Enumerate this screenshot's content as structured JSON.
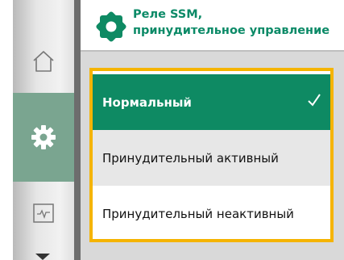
{
  "header": {
    "title_line1": "Реле SSM,",
    "title_line2": "принудительное управление",
    "icon": "gear-icon"
  },
  "rail": {
    "items": [
      {
        "name": "home",
        "icon": "house-icon"
      },
      {
        "name": "settings",
        "icon": "gear-icon",
        "active": true
      },
      {
        "name": "status",
        "icon": "pulse-monitor-icon"
      }
    ],
    "scroll_icon": "triangle-down-icon"
  },
  "options": [
    {
      "label": "Нормальный",
      "selected": true,
      "indicator": "checkmark-icon"
    },
    {
      "label": "Принудительный активный",
      "selected": false
    },
    {
      "label": "Принудительный неактивный",
      "selected": false
    }
  ],
  "colors": {
    "brand_green": "#0e8a63",
    "focus_border": "#f5b400",
    "rail_active": "#7aa590"
  }
}
